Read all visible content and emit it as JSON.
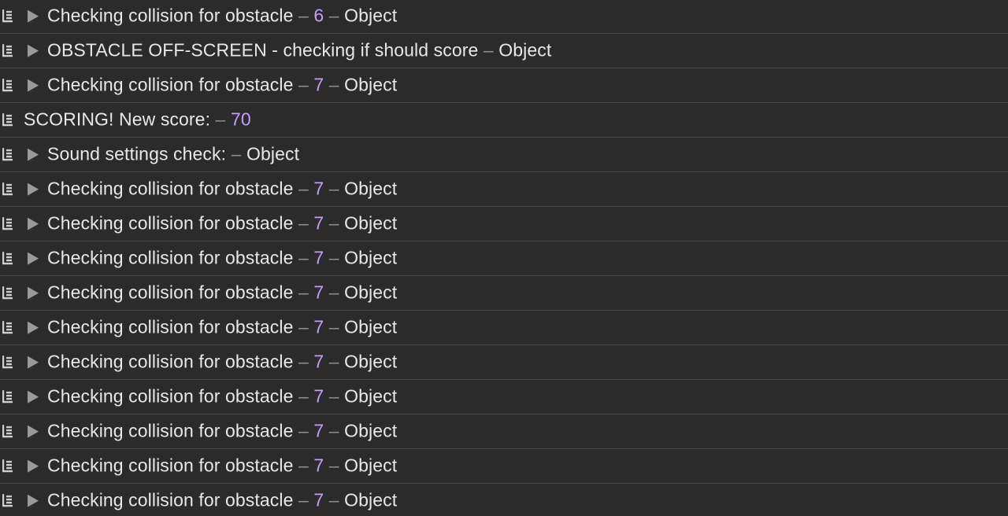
{
  "console": {
    "separator": " – ",
    "entries": [
      {
        "expandable": true,
        "text": "Checking collision for obstacle",
        "number": "6",
        "suffix": "Object"
      },
      {
        "expandable": true,
        "text": "OBSTACLE OFF-SCREEN - checking if should score",
        "number": null,
        "suffix": "Object"
      },
      {
        "expandable": true,
        "text": "Checking collision for obstacle",
        "number": "7",
        "suffix": "Object"
      },
      {
        "expandable": false,
        "text": "SCORING! New score:",
        "number": "70",
        "suffix": null
      },
      {
        "expandable": true,
        "text": "Sound settings check:",
        "number": null,
        "suffix": "Object"
      },
      {
        "expandable": true,
        "text": "Checking collision for obstacle",
        "number": "7",
        "suffix": "Object"
      },
      {
        "expandable": true,
        "text": "Checking collision for obstacle",
        "number": "7",
        "suffix": "Object"
      },
      {
        "expandable": true,
        "text": "Checking collision for obstacle",
        "number": "7",
        "suffix": "Object"
      },
      {
        "expandable": true,
        "text": "Checking collision for obstacle",
        "number": "7",
        "suffix": "Object"
      },
      {
        "expandable": true,
        "text": "Checking collision for obstacle",
        "number": "7",
        "suffix": "Object"
      },
      {
        "expandable": true,
        "text": "Checking collision for obstacle",
        "number": "7",
        "suffix": "Object"
      },
      {
        "expandable": true,
        "text": "Checking collision for obstacle",
        "number": "7",
        "suffix": "Object"
      },
      {
        "expandable": true,
        "text": "Checking collision for obstacle",
        "number": "7",
        "suffix": "Object"
      },
      {
        "expandable": true,
        "text": "Checking collision for obstacle",
        "number": "7",
        "suffix": "Object"
      },
      {
        "expandable": true,
        "text": "Checking collision for obstacle",
        "number": "7",
        "suffix": "Object"
      }
    ]
  },
  "icons": {
    "log": "log-entry-icon",
    "disclosure": "disclosure-triangle-icon"
  },
  "colors": {
    "background": "#2b2b2b",
    "text": "#e8e8e8",
    "separator": "#8e8e8e",
    "number": "#c79cf7",
    "divider": "#474747"
  }
}
